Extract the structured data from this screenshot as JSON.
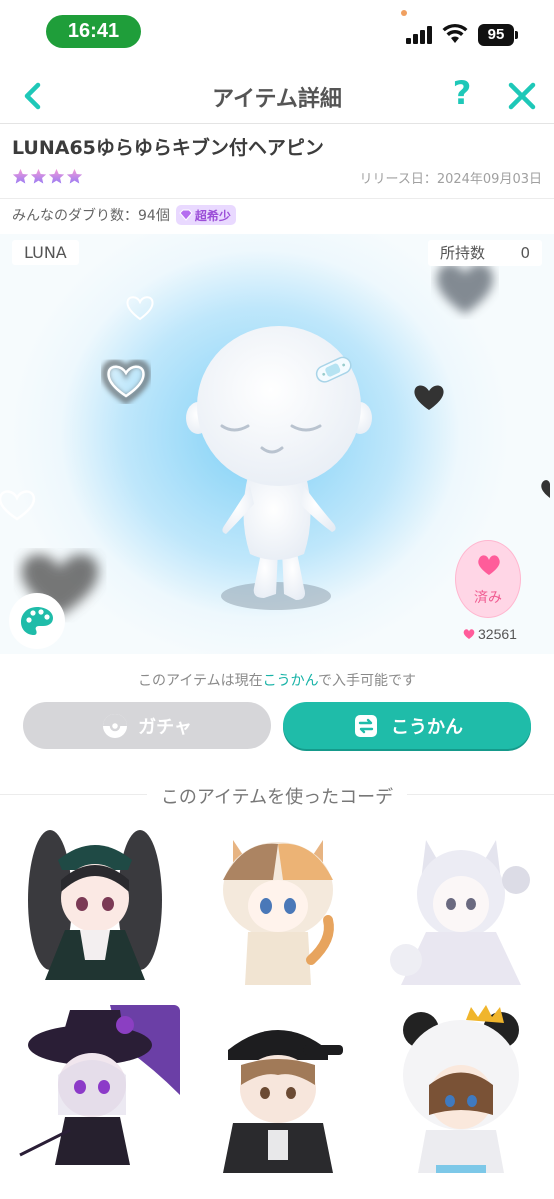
{
  "status_bar": {
    "time": "16:41",
    "battery": "95"
  },
  "nav": {
    "title": "アイテム詳細",
    "help": "?"
  },
  "item": {
    "name": "LUNA65ゆらゆらキブン付ヘアピン",
    "rarity_stars": 4,
    "release_date": "リリース日：2024年09月03日",
    "duplicates": "みんなのダブり数：94個",
    "rarity_badge": "超希少"
  },
  "preview": {
    "brand": "LUNA",
    "owned_label": "所持数",
    "owned_count": "0",
    "like_label": "済み",
    "like_count": "32561"
  },
  "availability": {
    "prefix": "このアイテムは現在",
    "highlight": "こうかん",
    "suffix": "で入手可能です"
  },
  "buttons": {
    "gacha": "ガチャ",
    "trade": "こうかん"
  },
  "coordinates": {
    "title": "このアイテムを使ったコーデ"
  },
  "colors": {
    "accent": "#1fbca9",
    "pink": "#f05a90",
    "rare": "#9c4fd8"
  }
}
